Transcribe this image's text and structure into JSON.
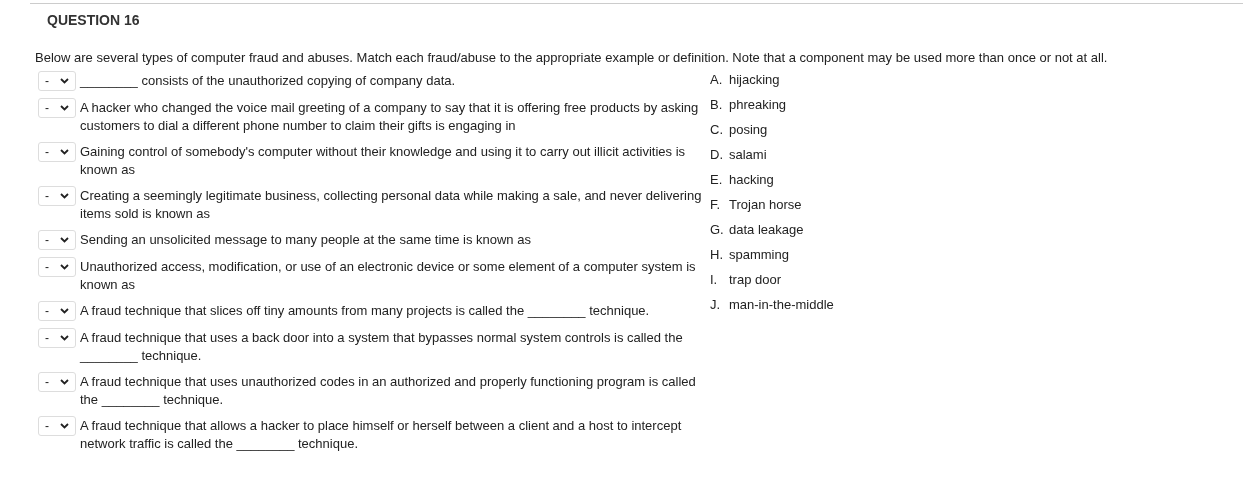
{
  "question": {
    "title": "QUESTION 16",
    "instructions": "Below are several types of computer fraud and abuses. Match each fraud/abuse to the appropriate example or definition. Note that a component may be used more than once or not at all."
  },
  "items": [
    {
      "value": "-",
      "text": "________ consists of the unauthorized copying of company data."
    },
    {
      "value": "-",
      "text": "A hacker who changed the voice mail greeting of a company to say that it is offering free products by asking customers to dial a different phone number to claim their gifts is engaging in"
    },
    {
      "value": "-",
      "text": "Gaining control of somebody's computer without their knowledge and using it to carry out illicit activities is known as"
    },
    {
      "value": "-",
      "text": "Creating a seemingly legitimate business, collecting personal data while making a sale, and never delivering items sold is known as"
    },
    {
      "value": "-",
      "text": "Sending an unsolicited message to many people at the same time is known as"
    },
    {
      "value": "-",
      "text": "Unauthorized access, modification, or use of an electronic device or some element of a computer system is known as"
    },
    {
      "value": "-",
      "text": "A fraud technique that slices off tiny amounts from many projects is called the ________ technique."
    },
    {
      "value": "-",
      "text": "A fraud technique that uses a back door into a system that bypasses normal system controls is called the ________ technique."
    },
    {
      "value": "-",
      "text": "A fraud technique that uses unauthorized codes in an authorized and properly functioning program is called the ________ technique."
    },
    {
      "value": "-",
      "text": "A fraud technique that allows a hacker to place himself or herself between a client and a host to intercept network traffic is called the ________ technique."
    }
  ],
  "options": [
    {
      "letter": "A.",
      "text": "hijacking"
    },
    {
      "letter": "B.",
      "text": "phreaking"
    },
    {
      "letter": "C.",
      "text": "posing"
    },
    {
      "letter": "D.",
      "text": "salami"
    },
    {
      "letter": "E.",
      "text": "hacking"
    },
    {
      "letter": "F.",
      "text": "Trojan horse"
    },
    {
      "letter": "G.",
      "text": "data leakage"
    },
    {
      "letter": "H.",
      "text": "spamming"
    },
    {
      "letter": "I.",
      "text": "trap door"
    },
    {
      "letter": "J.",
      "text": "man-in-the-middle"
    }
  ]
}
